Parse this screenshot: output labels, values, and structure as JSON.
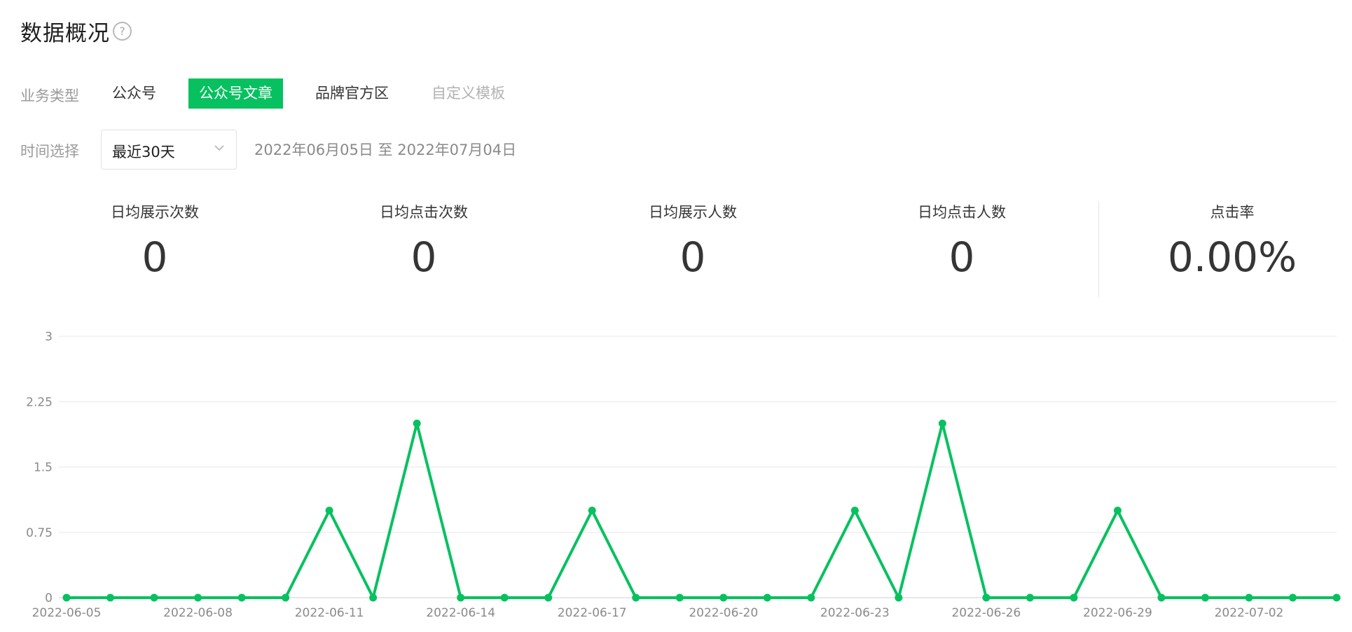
{
  "header": {
    "title": "数据概况",
    "help_glyph": "?"
  },
  "filters": {
    "business_type_label": "业务类型",
    "types": [
      {
        "label": "公众号",
        "state": "normal"
      },
      {
        "label": "公众号文章",
        "state": "active"
      },
      {
        "label": "品牌官方区",
        "state": "normal"
      },
      {
        "label": "自定义模板",
        "state": "disabled"
      }
    ],
    "time_label": "时间选择",
    "time_select_value": "最近30天",
    "date_range": "2022年06月05日 至 2022年07月04日"
  },
  "metrics": [
    {
      "label": "日均展示次数",
      "value": "0"
    },
    {
      "label": "日均点击次数",
      "value": "0"
    },
    {
      "label": "日均展示人数",
      "value": "0"
    },
    {
      "label": "日均点击人数",
      "value": "0"
    },
    {
      "label": "点击率",
      "value": "0.00%"
    }
  ],
  "colors": {
    "accent": "#07c160",
    "gridline": "#e8e8e8",
    "axis": "#cfcfcf"
  },
  "chart_data": {
    "type": "line",
    "x": [
      "2022-06-05",
      "2022-06-06",
      "2022-06-07",
      "2022-06-08",
      "2022-06-09",
      "2022-06-10",
      "2022-06-11",
      "2022-06-12",
      "2022-06-13",
      "2022-06-14",
      "2022-06-15",
      "2022-06-16",
      "2022-06-17",
      "2022-06-18",
      "2022-06-19",
      "2022-06-20",
      "2022-06-21",
      "2022-06-22",
      "2022-06-23",
      "2022-06-24",
      "2022-06-25",
      "2022-06-26",
      "2022-06-27",
      "2022-06-28",
      "2022-06-29",
      "2022-06-30",
      "2022-07-01",
      "2022-07-02",
      "2022-07-03",
      "2022-07-04"
    ],
    "x_tick_labels": [
      "2022-06-05",
      "2022-06-08",
      "2022-06-11",
      "2022-06-14",
      "2022-06-17",
      "2022-06-20",
      "2022-06-23",
      "2022-06-26",
      "2022-06-29",
      "2022-07-02"
    ],
    "series": [
      {
        "values": [
          0,
          0,
          0,
          0,
          0,
          0,
          1,
          0,
          2,
          0,
          0,
          0,
          1,
          0,
          0,
          0,
          0,
          0,
          1,
          0,
          2,
          0,
          0,
          0,
          1,
          0,
          0,
          0,
          0,
          0
        ]
      }
    ],
    "y_ticks": [
      "0",
      "0.75",
      "1.5",
      "2.25",
      "3"
    ],
    "ylim": [
      0,
      3
    ],
    "grid": true,
    "legend": "none"
  }
}
